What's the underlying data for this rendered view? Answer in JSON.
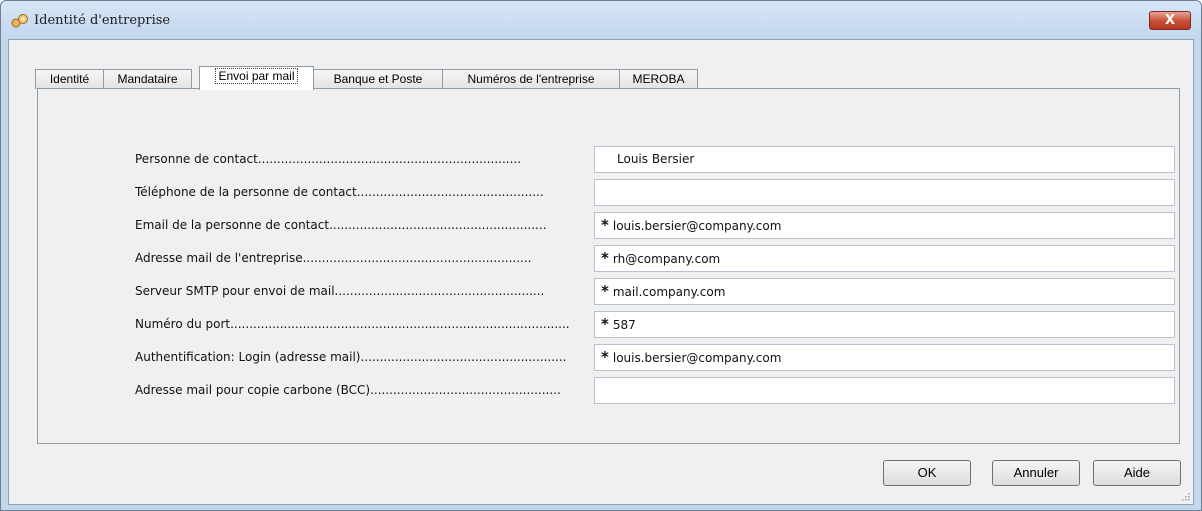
{
  "window": {
    "title": "Identité d'entreprise"
  },
  "tabs": [
    {
      "label": "Identité"
    },
    {
      "label": "Mandataire"
    },
    {
      "label": "Envoi par mail",
      "active": true
    },
    {
      "label": "Banque et Poste"
    },
    {
      "label": "Numéros de l'entreprise"
    },
    {
      "label": "MEROBA"
    }
  ],
  "form": {
    "rows": [
      {
        "label": "Personne de contact.....................................................................",
        "value": "Louis Bersier",
        "required": false
      },
      {
        "label": "Téléphone de la personne de contact.................................................",
        "value": "",
        "required": false
      },
      {
        "label": "Email de la personne de contact.........................................................",
        "value": "louis.bersier@company.com",
        "required": true
      },
      {
        "label": "Adresse mail de l'entreprise............................................................",
        "value": "rh@company.com",
        "required": true
      },
      {
        "label": "Serveur SMTP pour envoi de mail.......................................................",
        "value": "mail.company.com",
        "required": true
      },
      {
        "label": "Numéro du port.........................................................................................",
        "value": "587",
        "required": true
      },
      {
        "label": "Authentification: Login (adresse mail)......................................................",
        "value": "louis.bersier@company.com",
        "required": true
      },
      {
        "label": "Adresse mail pour copie carbone (BCC)..................................................",
        "value": "",
        "required": false
      }
    ],
    "required_mark": "*"
  },
  "buttons": {
    "ok": "OK",
    "cancel": "Annuler",
    "help": "Aide"
  },
  "close_label": "X",
  "colors": {
    "close_red": "#c94b35",
    "titlebar": "#c4d6ec"
  }
}
